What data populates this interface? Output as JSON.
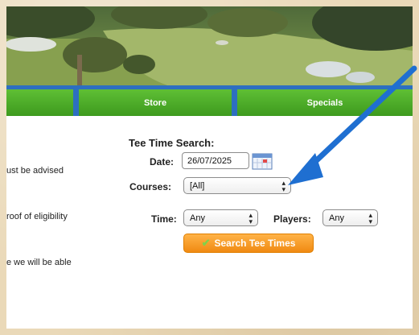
{
  "nav": {
    "store": "Store",
    "specials": "Specials"
  },
  "left_snippets": [
    "ust be advised",
    "roof of eligibility",
    "e we will be able"
  ],
  "search": {
    "title": "Tee Time Search:",
    "date_label": "Date:",
    "date_value": "26/07/2025",
    "courses_label": "Courses:",
    "courses_value": "[All]",
    "time_label": "Time:",
    "time_value": "Any",
    "players_label": "Players:",
    "players_value": "Any",
    "button_label": "Search Tee Times"
  },
  "colors": {
    "nav_green": "#4caf2a",
    "nav_blue": "#2d6fc0",
    "button_orange": "#f59a1f",
    "arrow_blue": "#1f6fd1"
  },
  "icons": [
    "calendar-icon",
    "checkmark-icon",
    "chevron-updown-icon",
    "pointer-arrow"
  ]
}
